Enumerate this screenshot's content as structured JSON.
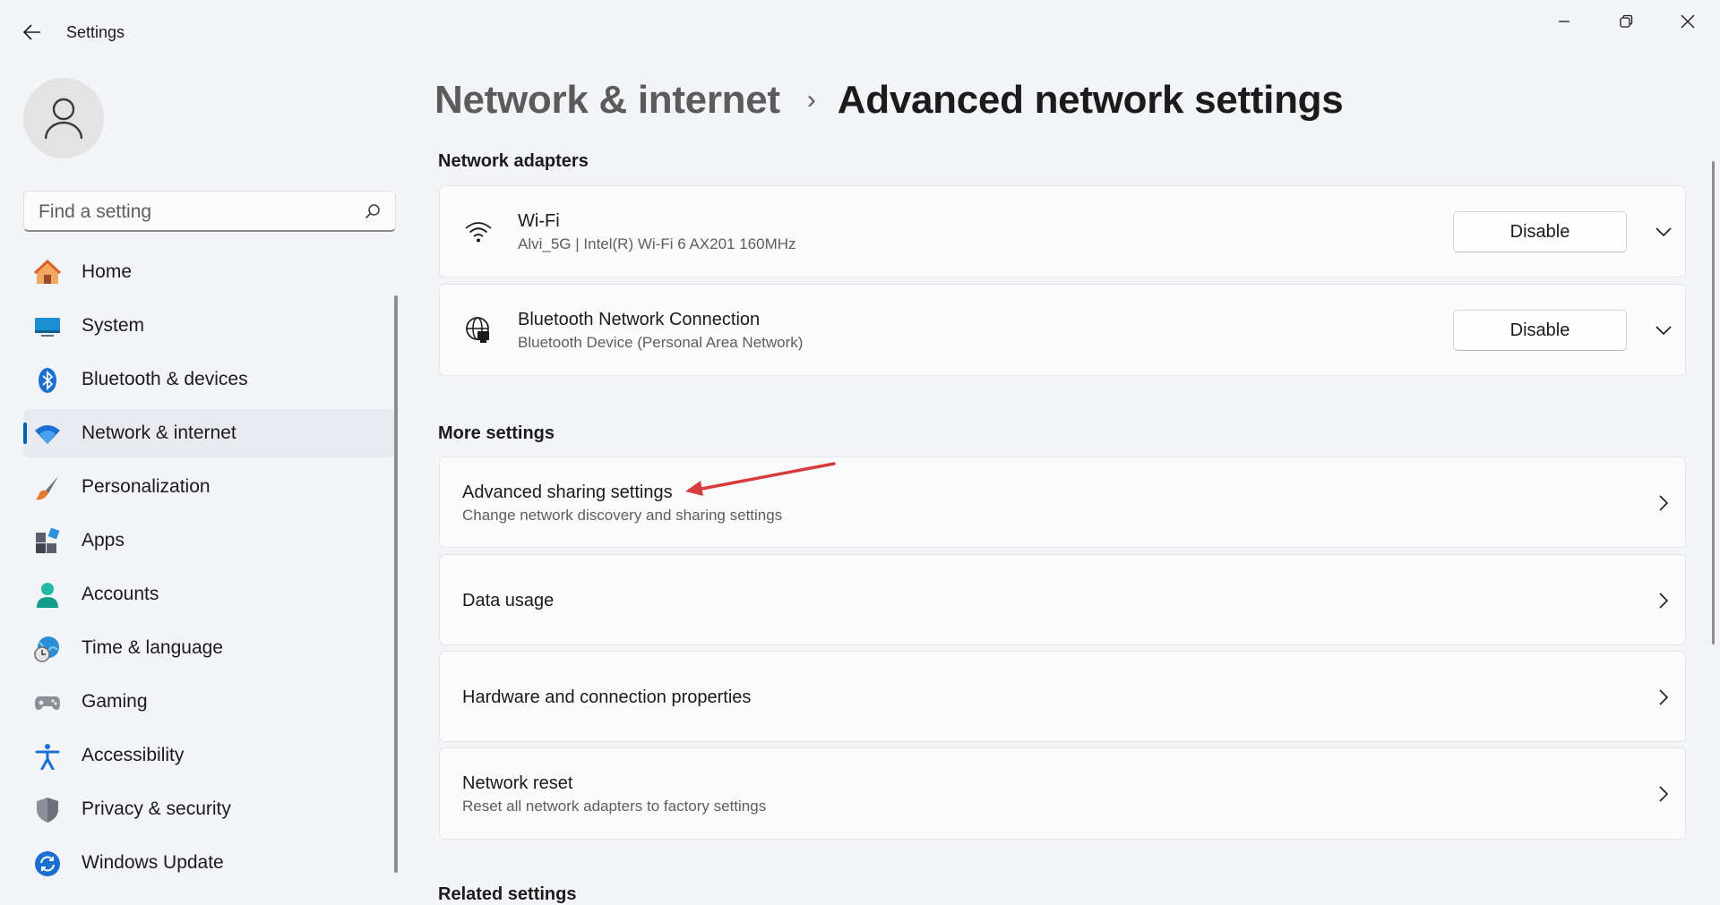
{
  "window": {
    "title": "Settings"
  },
  "sidebar": {
    "search": {
      "placeholder": "Find a setting",
      "value": ""
    },
    "items": [
      {
        "label": "Home",
        "icon": "home-icon"
      },
      {
        "label": "System",
        "icon": "system-icon"
      },
      {
        "label": "Bluetooth & devices",
        "icon": "bluetooth-icon"
      },
      {
        "label": "Network & internet",
        "icon": "wifi-icon",
        "selected": true
      },
      {
        "label": "Personalization",
        "icon": "brush-icon"
      },
      {
        "label": "Apps",
        "icon": "apps-icon"
      },
      {
        "label": "Accounts",
        "icon": "person-icon"
      },
      {
        "label": "Time & language",
        "icon": "globe-clock-icon"
      },
      {
        "label": "Gaming",
        "icon": "gamepad-icon"
      },
      {
        "label": "Accessibility",
        "icon": "accessibility-icon"
      },
      {
        "label": "Privacy & security",
        "icon": "shield-icon"
      },
      {
        "label": "Windows Update",
        "icon": "update-icon"
      }
    ]
  },
  "breadcrumb": {
    "parent": "Network & internet",
    "separator": "›",
    "current": "Advanced network settings"
  },
  "network_adapters": {
    "title": "Network adapters",
    "items": [
      {
        "name": "Wi-Fi",
        "detail": "Alvi_5G | Intel(R) Wi-Fi 6 AX201 160MHz",
        "button": "Disable",
        "icon": "wifi-icon"
      },
      {
        "name": "Bluetooth Network Connection",
        "detail": "Bluetooth Device (Personal Area Network)",
        "button": "Disable",
        "icon": "ethernet-globe-icon"
      }
    ]
  },
  "more_settings": {
    "title": "More settings",
    "items": [
      {
        "label": "Advanced sharing settings",
        "sub": "Change network discovery and sharing settings"
      },
      {
        "label": "Data usage",
        "sub": ""
      },
      {
        "label": "Hardware and connection properties",
        "sub": ""
      },
      {
        "label": "Network reset",
        "sub": "Reset all network adapters to factory settings"
      }
    ]
  },
  "related_settings": {
    "title": "Related settings"
  },
  "colors": {
    "accent": "#005fb8",
    "annotation_arrow": "#d83b3b",
    "background": "#f2f4f8",
    "card": "#fbfbfc"
  }
}
